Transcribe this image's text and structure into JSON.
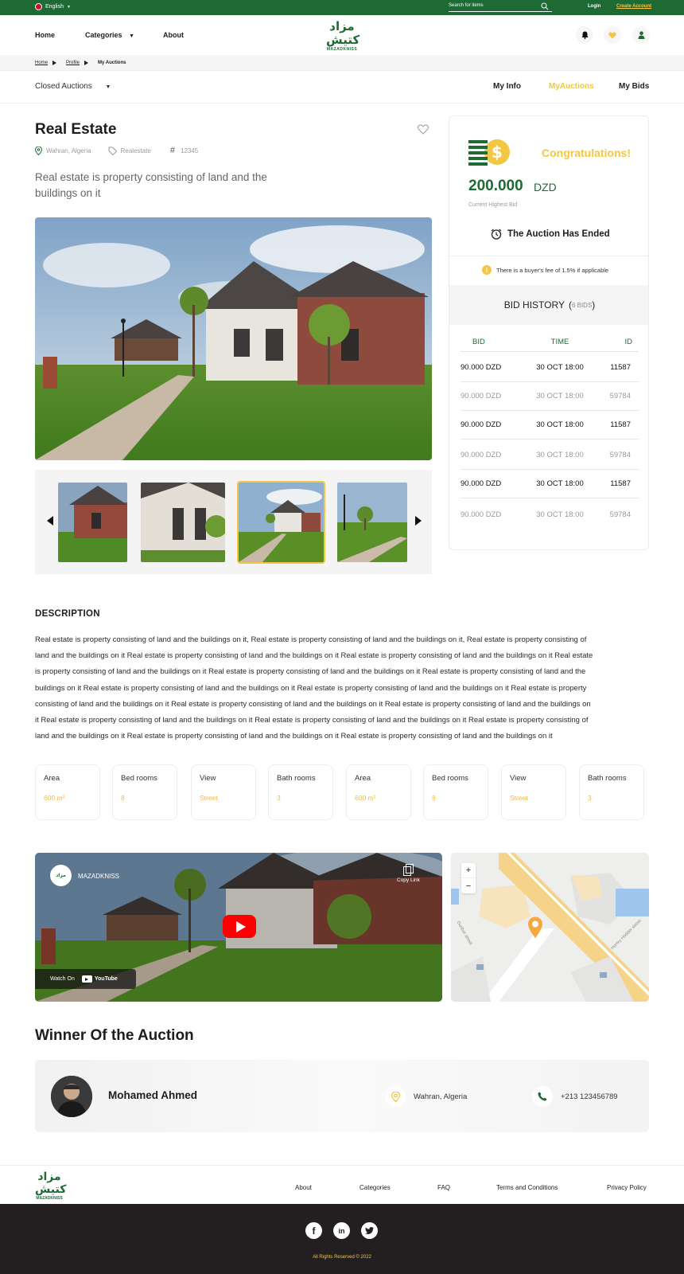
{
  "topbar": {
    "language": "English",
    "search_placeholder": "Search for items",
    "login": "Login",
    "create_account": "Create Account"
  },
  "header": {
    "nav": [
      "Home",
      "Categories",
      "About"
    ],
    "logo_arabic": "مزاد كتيش",
    "logo_latin": "MAZADKNISS"
  },
  "breadcrumb": [
    "Home",
    "Profile",
    "My Auctions"
  ],
  "subnav": {
    "filter": "Closed Auctions",
    "tabs": [
      "My Info",
      "MyAuctions",
      "My Bids"
    ],
    "active_tab": "MyAuctions"
  },
  "listing": {
    "title": "Real Estate",
    "location": "Wahran, Algeria",
    "category": "Realestate",
    "id": "12345",
    "summary": "Real estate is property consisting of land and the buildings on it"
  },
  "panel": {
    "congrats": "Congratulations!",
    "amount": "200.000",
    "currency": "DZD",
    "amount_label": "Current Highest Bid",
    "ended": "The Auction Has Ended",
    "fee_note": "There is a buyer's fee of 1.5% if applicable",
    "history_title": "BID HISTORY",
    "history_count": "6 BIDS",
    "columns": [
      "BID",
      "TIME",
      "ID"
    ],
    "bids": [
      {
        "bid": "90.000 DZD",
        "time": "30 OCT 18:00",
        "id": "11587"
      },
      {
        "bid": "90.000 DZD",
        "time": "30 OCT 18:00",
        "id": "59784"
      },
      {
        "bid": "90.000 DZD",
        "time": "30 OCT 18:00",
        "id": "11587"
      },
      {
        "bid": "90.000 DZD",
        "time": "30 OCT 18:00",
        "id": "59784"
      },
      {
        "bid": "90.000 DZD",
        "time": "30 OCT 18:00",
        "id": "11587"
      },
      {
        "bid": "90.000 DZD",
        "time": "30 OCT 18:00",
        "id": "59784"
      }
    ]
  },
  "description": {
    "heading": "DESCRIPTION",
    "text": "Real estate is property consisting of land and the buildings on it, Real estate is property consisting of land and the buildings on it, Real estate is property consisting of land and the buildings on it Real estate is property consisting of land and the buildings on it Real estate is property consisting of land and the buildings on it Real estate is property consisting of land and the buildings on it Real estate is property consisting of land and the buildings on it Real estate is property consisting of land and the buildings on it Real estate is property consisting of land and the buildings on it Real estate is property consisting of land and the buildings on it Real estate is property consisting of land and the buildings on it Real estate is property consisting of land and the buildings on it Real estate is property consisting of land and the buildings on it Real estate is property consisting of land and the buildings on it Real estate is property consisting of land and the buildings on it Real estate is property consisting of land and the buildings on it Real estate is property consisting of land and the buildings on it Real estate is property consisting of land and the buildings on it"
  },
  "features": [
    {
      "k": "Area",
      "v": "600 m²"
    },
    {
      "k": "Bed rooms",
      "v": "8"
    },
    {
      "k": "View",
      "v": "Street"
    },
    {
      "k": "Bath rooms",
      "v": "3"
    },
    {
      "k": "Area",
      "v": "600 m²"
    },
    {
      "k": "Bed rooms",
      "v": "8"
    },
    {
      "k": "View",
      "v": "Street"
    },
    {
      "k": "Bath rooms",
      "v": "3"
    }
  ],
  "video": {
    "channel": "MAZADKNISS",
    "copy_link": "Copy Link",
    "watch_on": "Watch On",
    "youtube": "YouTube"
  },
  "map": {
    "zoom_in": "+",
    "zoom_out": "−",
    "street_1": "Dunbar street",
    "street_2": "Hemry Hodder street"
  },
  "winner": {
    "heading": "Winner Of the Auction",
    "name": "Mohamed Ahmed",
    "location": "Wahran, Algeria",
    "phone": "+213 123456789"
  },
  "footer": {
    "links": [
      "About",
      "Categories",
      "FAQ",
      "Terms and Conditions",
      "Privacy Policy"
    ],
    "copyright": "All Rights Reserved © 2022"
  },
  "colors": {
    "brand_green": "#1d6a34",
    "accent_yellow": "#f3c744",
    "footer_dark": "#231f20"
  }
}
